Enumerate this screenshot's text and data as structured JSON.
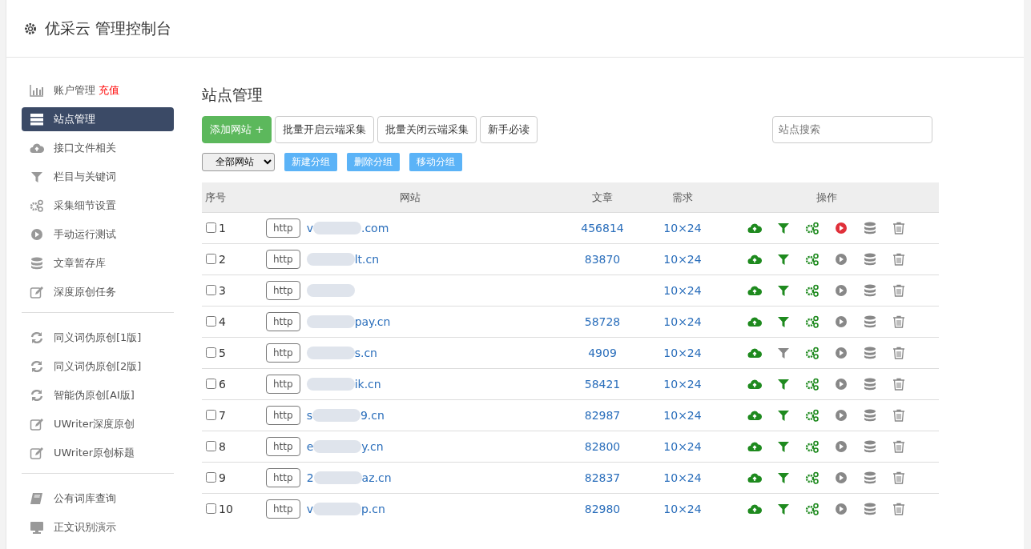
{
  "header": {
    "title": "优采云 管理控制台"
  },
  "sidebar": {
    "groups": [
      [
        {
          "kind": "chart",
          "label": "账户管理",
          "link": "充值",
          "selected": false
        },
        {
          "kind": "server",
          "label": "站点管理",
          "selected": true
        },
        {
          "kind": "cloud",
          "label": "接口文件相关",
          "selected": false
        },
        {
          "kind": "filter",
          "label": "栏目与关键词",
          "selected": false
        },
        {
          "kind": "gears",
          "label": "采集细节设置",
          "selected": false
        },
        {
          "kind": "play",
          "label": "手动运行测试",
          "selected": false
        },
        {
          "kind": "database",
          "label": "文章暂存库",
          "selected": false
        },
        {
          "kind": "edit",
          "label": "深度原创任务",
          "selected": false
        }
      ],
      [
        {
          "kind": "refresh",
          "label": "同义词伪原创[1版]",
          "selected": false
        },
        {
          "kind": "refresh",
          "label": "同义词伪原创[2版]",
          "selected": false
        },
        {
          "kind": "refresh",
          "label": "智能伪原创[AI版]",
          "selected": false
        },
        {
          "kind": "edit",
          "label": "UWriter深度原创",
          "selected": false
        },
        {
          "kind": "edit",
          "label": "UWriter原创标题",
          "selected": false
        }
      ],
      [
        {
          "kind": "book",
          "label": "公有词库查询",
          "selected": false
        },
        {
          "kind": "monitor",
          "label": "正文识别演示",
          "selected": false
        }
      ]
    ]
  },
  "main": {
    "title": "站点管理",
    "toolbar": [
      {
        "kind": "primary",
        "label": "添加网站 +"
      },
      {
        "kind": "plain",
        "label": "批量开启云端采集"
      },
      {
        "kind": "plain",
        "label": "批量关闭云端采集"
      },
      {
        "kind": "plain",
        "label": "新手必读"
      }
    ],
    "search": {
      "placeholder": "站点搜索"
    },
    "group_select": {
      "value": "全部网站"
    },
    "group_buttons": [
      "新建分组",
      "删除分组",
      "移动分组"
    ],
    "table": {
      "columns": [
        "序号",
        "网站",
        "文章",
        "需求",
        "操作"
      ],
      "rows": [
        {
          "index": "1",
          "checked": false,
          "scheme": "http",
          "domain_start": "v",
          "domain_end": ".com",
          "articles": "456814",
          "demand": "10×24",
          "filter_on": true,
          "running": true
        },
        {
          "index": "2",
          "checked": false,
          "scheme": "http",
          "domain_end": "lt.cn",
          "articles": "83870",
          "demand": "10×24",
          "filter_on": true,
          "running": false
        },
        {
          "index": "3",
          "checked": false,
          "scheme": "http",
          "demand": "10×24",
          "filter_on": true,
          "running": false
        },
        {
          "index": "4",
          "checked": false,
          "scheme": "http",
          "domain_end": "pay.cn",
          "articles": "58728",
          "demand": "10×24",
          "filter_on": true,
          "running": false
        },
        {
          "index": "5",
          "checked": false,
          "scheme": "http",
          "domain_end": "s.cn",
          "articles": "4909",
          "demand": "10×24",
          "filter_on": false,
          "running": false
        },
        {
          "index": "6",
          "checked": false,
          "scheme": "http",
          "domain_end": "ik.cn",
          "articles": "58421",
          "demand": "10×24",
          "filter_on": true,
          "running": false
        },
        {
          "index": "7",
          "checked": false,
          "scheme": "http",
          "domain_start": "s",
          "domain_end": "9.cn",
          "articles": "82987",
          "demand": "10×24",
          "filter_on": true,
          "running": false
        },
        {
          "index": "8",
          "checked": false,
          "scheme": "http",
          "domain_start": "e",
          "domain_end": "y.cn",
          "articles": "82800",
          "demand": "10×24",
          "filter_on": true,
          "running": false
        },
        {
          "index": "9",
          "checked": false,
          "scheme": "http",
          "domain_start": "2",
          "domain_end": "az.cn",
          "articles": "82837",
          "demand": "10×24",
          "filter_on": true,
          "running": false
        },
        {
          "index": "10",
          "checked": false,
          "scheme": "http",
          "domain_start": "v",
          "domain_end": "p.cn",
          "articles": "82980",
          "demand": "10×24",
          "filter_on": true,
          "running": false
        }
      ]
    }
  }
}
